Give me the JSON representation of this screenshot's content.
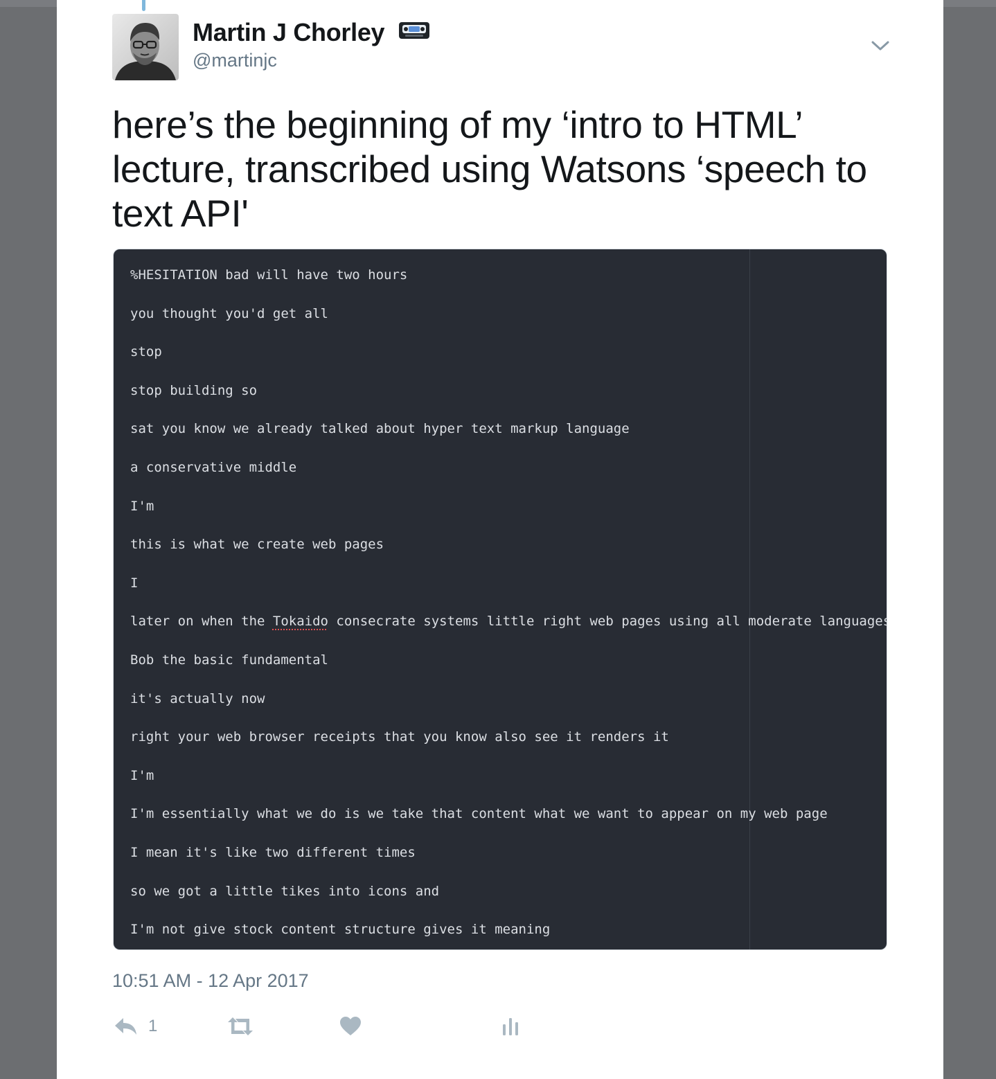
{
  "tweet": {
    "display_name": "Martin J Chorley",
    "handle": "@martinjc",
    "emoji_icon": "videocassette-icon",
    "text_lines": [
      "here’s the beginning of my ‘intro to HTML’",
      "lecture, transcribed using Watsons ‘speech to",
      "text API'"
    ],
    "timestamp": "10:51 AM - 12 Apr 2017",
    "actions": {
      "reply_count": "1",
      "reply_icon": "reply-icon",
      "retweet_icon": "retweet-icon",
      "like_icon": "heart-icon",
      "analytics_icon": "analytics-icon",
      "menu_icon": "chevron-down-icon"
    }
  },
  "media": {
    "background": "#282c34",
    "transcript": [
      "%HESITATION bad will have two hours",
      "you thought you'd get all",
      "stop",
      "stop building so",
      "sat you know we already talked about hyper text markup language",
      "a conservative middle",
      "I'm",
      "this is what we create web pages",
      "I",
      "later on when the Tokaido consecrate systems little right web pages using all moderate languages",
      "Bob the basic fundamental",
      "it's actually now",
      "right your web browser receipts that you know also see it renders it",
      "I'm",
      "I'm essentially what we do is we take that content what we want to appear on my web page",
      "I mean it's like two different times",
      "so we got a little tikes into icons and",
      "I'm not give stock content structure gives it meaning"
    ],
    "spellcheck_word": "Tokaido"
  },
  "colors": {
    "page_background": "#6c6e71",
    "text_primary": "#14171a",
    "text_secondary": "#657786",
    "action_icons": "#aab8c2"
  }
}
